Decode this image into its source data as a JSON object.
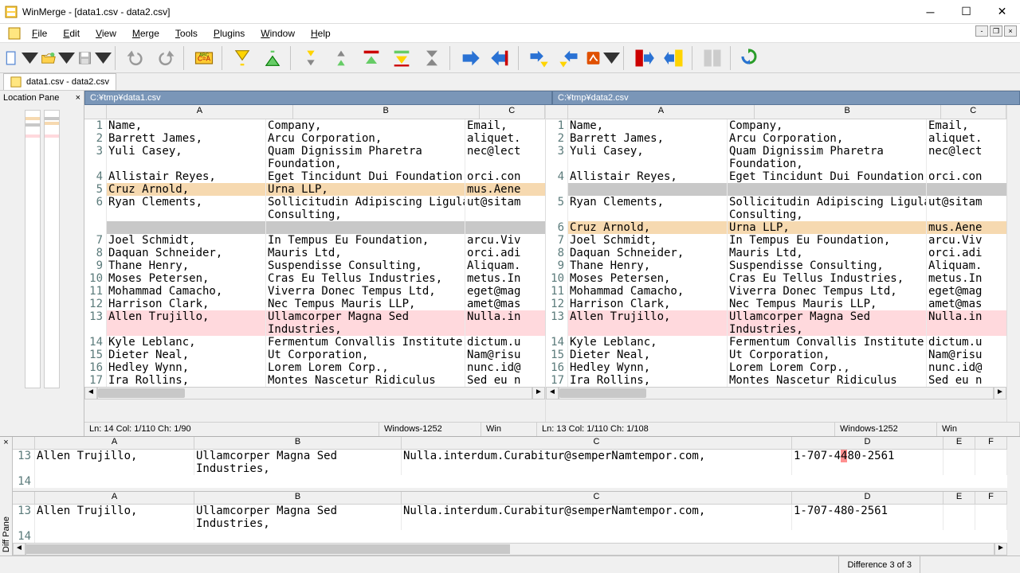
{
  "window": {
    "title": "WinMerge - [data1.csv - data2.csv]"
  },
  "menus": [
    "File",
    "Edit",
    "View",
    "Merge",
    "Tools",
    "Plugins",
    "Window",
    "Help"
  ],
  "doc_tab": "data1.csv - data2.csv",
  "locpane_label": "Location Pane",
  "left_path": "C:¥tmp¥data1.csv",
  "right_path": "C:¥tmp¥data2.csv",
  "cols": [
    "A",
    "B",
    "C"
  ],
  "left_rows": [
    {
      "n": 1,
      "a": "Name,",
      "b": "Company,",
      "c": "Email,"
    },
    {
      "n": 2,
      "a": "Barrett James,",
      "b": "Arcu Corporation,",
      "c": "aliquet."
    },
    {
      "n": 3,
      "a": "Yuli Casey,",
      "b": "Quam Dignissim Pharetra Foundation,",
      "c": "nec@lect"
    },
    {
      "n": 4,
      "a": "Allistair Reyes,",
      "b": "Eget Tincidunt Dui Foundation,",
      "c": "orci.con"
    },
    {
      "n": 5,
      "a": "Cruz Arnold,",
      "b": "Urna LLP,",
      "c": "mus.Aene",
      "cls": "moved"
    },
    {
      "n": 6,
      "a": "Ryan Clements,",
      "b": "Sollicitudin Adipiscing Ligula Consulting,",
      "c": "ut@sitam"
    },
    {
      "n": "",
      "a": "",
      "b": "",
      "c": "",
      "cls": "grey"
    },
    {
      "n": 7,
      "a": "Joel Schmidt,",
      "b": "In Tempus Eu Foundation,",
      "c": "arcu.Viv"
    },
    {
      "n": 8,
      "a": "Daquan Schneider,",
      "b": "Mauris Ltd,",
      "c": "orci.adi"
    },
    {
      "n": 9,
      "a": "Thane Henry,",
      "b": "Suspendisse Consulting,",
      "c": "Aliquam."
    },
    {
      "n": 10,
      "a": "Moses Petersen,",
      "b": "Cras Eu Tellus Industries,",
      "c": "metus.In"
    },
    {
      "n": 11,
      "a": "Mohammad Camacho,",
      "b": "Viverra Donec Tempus Ltd,",
      "c": "eget@mag"
    },
    {
      "n": 12,
      "a": "Harrison Clark,",
      "b": "Nec Tempus Mauris LLP,",
      "c": "amet@mas"
    },
    {
      "n": 13,
      "a": "Allen Trujillo,",
      "b": "Ullamcorper Magna Sed Industries,",
      "c": "Nulla.in",
      "cls": "pink"
    },
    {
      "n": 14,
      "a": "Kyle Leblanc,",
      "b": "Fermentum Convallis Institute,",
      "c": "dictum.u"
    },
    {
      "n": 15,
      "a": "Dieter Neal,",
      "b": "Ut Corporation,",
      "c": "Nam@risu"
    },
    {
      "n": 16,
      "a": "Hedley Wynn,",
      "b": "Lorem Lorem Corp.,",
      "c": "nunc.id@"
    },
    {
      "n": 17,
      "a": "Ira Rollins,",
      "b": "Montes Nascetur Ridiculus",
      "c": "Sed eu n"
    }
  ],
  "right_rows": [
    {
      "n": 1,
      "a": "Name,",
      "b": "Company,",
      "c": "Email,"
    },
    {
      "n": 2,
      "a": "Barrett James,",
      "b": "Arcu Corporation,",
      "c": "aliquet."
    },
    {
      "n": 3,
      "a": "Yuli Casey,",
      "b": "Quam Dignissim Pharetra Foundation,",
      "c": "nec@lect"
    },
    {
      "n": 4,
      "a": "Allistair Reyes,",
      "b": "Eget Tincidunt Dui Foundation,",
      "c": "orci.con"
    },
    {
      "n": "",
      "a": "",
      "b": "",
      "c": "",
      "cls": "grey"
    },
    {
      "n": 5,
      "a": "Ryan Clements,",
      "b": "Sollicitudin Adipiscing Ligula Consulting,",
      "c": "ut@sitam"
    },
    {
      "n": 6,
      "a": "Cruz Arnold,",
      "b": "Urna LLP,",
      "c": "mus.Aene",
      "cls": "moved"
    },
    {
      "n": 7,
      "a": "Joel Schmidt,",
      "b": "In Tempus Eu Foundation,",
      "c": "arcu.Viv"
    },
    {
      "n": 8,
      "a": "Daquan Schneider,",
      "b": "Mauris Ltd,",
      "c": "orci.adi"
    },
    {
      "n": 9,
      "a": "Thane Henry,",
      "b": "Suspendisse Consulting,",
      "c": "Aliquam."
    },
    {
      "n": 10,
      "a": "Moses Petersen,",
      "b": "Cras Eu Tellus Industries,",
      "c": "metus.In"
    },
    {
      "n": 11,
      "a": "Mohammad Camacho,",
      "b": "Viverra Donec Tempus Ltd,",
      "c": "eget@mag"
    },
    {
      "n": 12,
      "a": "Harrison Clark,",
      "b": "Nec Tempus Mauris LLP,",
      "c": "amet@mas"
    },
    {
      "n": 13,
      "a": "Allen Trujillo,",
      "b": "Ullamcorper Magna Sed Industries,",
      "c": "Nulla.in",
      "cls": "pink"
    },
    {
      "n": 14,
      "a": "Kyle Leblanc,",
      "b": "Fermentum Convallis Institute,",
      "c": "dictum.u"
    },
    {
      "n": 15,
      "a": "Dieter Neal,",
      "b": "Ut Corporation,",
      "c": "Nam@risu"
    },
    {
      "n": 16,
      "a": "Hedley Wynn,",
      "b": "Lorem Lorem Corp.,",
      "c": "nunc.id@"
    },
    {
      "n": 17,
      "a": "Ira Rollins,",
      "b": "Montes Nascetur Ridiculus",
      "c": "Sed eu n"
    }
  ],
  "info": {
    "left_pos": "Ln: 14  Col: 1/110  Ch: 1/90",
    "right_pos": "Ln: 13  Col: 1/110  Ch: 1/108",
    "encoding": "Windows-1252",
    "eol": "Win"
  },
  "diff_cols": [
    "A",
    "B",
    "C",
    "D",
    "E",
    "F"
  ],
  "diff_top": {
    "n": 13,
    "a": "Allen Trujillo,",
    "b": "Ullamcorper Magna Sed Industries,",
    "c": "Nulla.interdum.Curabitur@semperNamtempor.com,",
    "d": "1-707-4480-2561",
    "d_hl_idx": 7
  },
  "diff_bot": {
    "n": 13,
    "a": "Allen Trujillo,",
    "b": "Ullamcorper Magna Sed Industries,",
    "c": "Nulla.interdum.Curabitur@semperNamtempor.com,",
    "d": "1-707-480-2561"
  },
  "diffpane_label": "Diff Pane",
  "status": {
    "diff": "Difference 3 of 3"
  }
}
